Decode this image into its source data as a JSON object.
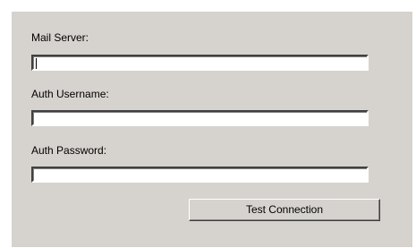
{
  "form": {
    "mail_server": {
      "label": "Mail Server:",
      "value": ""
    },
    "auth_username": {
      "label": "Auth Username:",
      "value": ""
    },
    "auth_password": {
      "label": "Auth Password:",
      "value": ""
    },
    "test_button_label": "Test Connection"
  },
  "colors": {
    "panel_background": "#d6d3ce",
    "page_background": "#ffffff",
    "field_background": "#ffffff"
  }
}
